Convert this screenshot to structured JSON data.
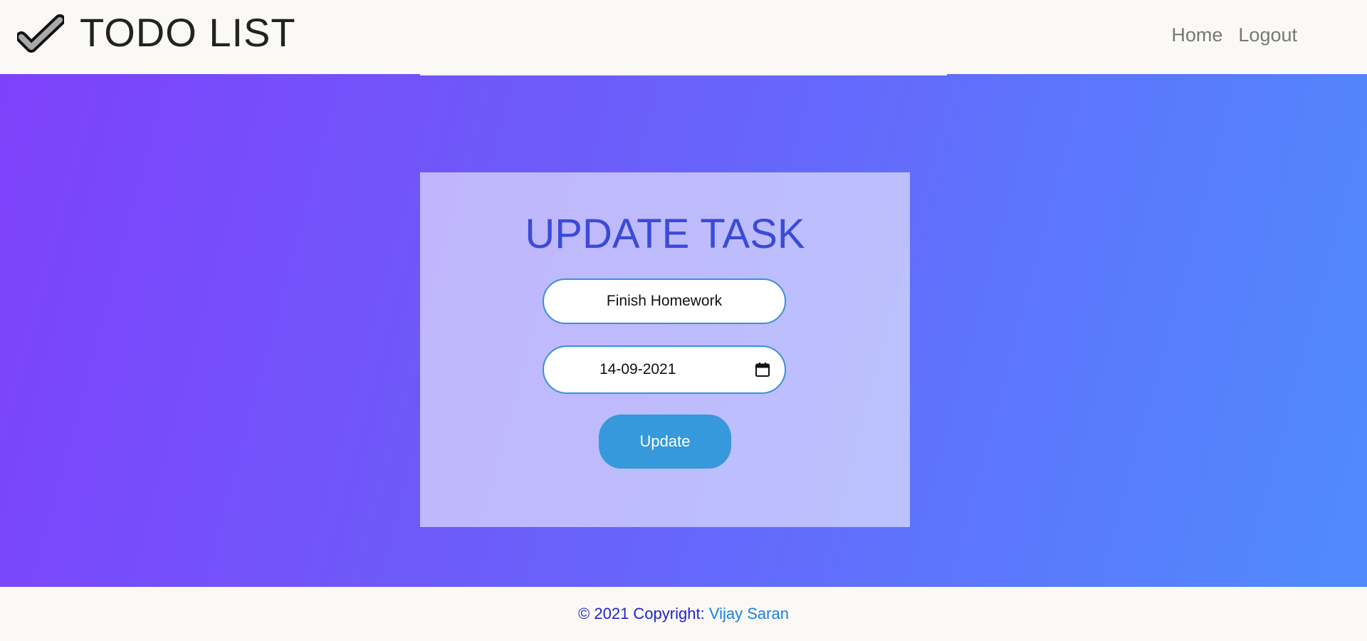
{
  "navbar": {
    "title": "TODO LIST",
    "logo_icon": "checkmark-icon",
    "links": [
      {
        "label": "Home"
      },
      {
        "label": "Logout"
      }
    ]
  },
  "form": {
    "heading": "UPDATE TASK",
    "task_value": "Finish Homework",
    "date_value": "14-09-2021",
    "date_icon": "calendar-icon",
    "submit_label": "Update"
  },
  "footer": {
    "copyright": "© 2021 Copyright:",
    "author": "Vijay Saran"
  },
  "colors": {
    "heading": "#3b4ad8",
    "button": "#3599dc",
    "input_border": "#3a8fd8",
    "gradient_start": "#7f40fb",
    "gradient_end": "#4f8cfe"
  }
}
